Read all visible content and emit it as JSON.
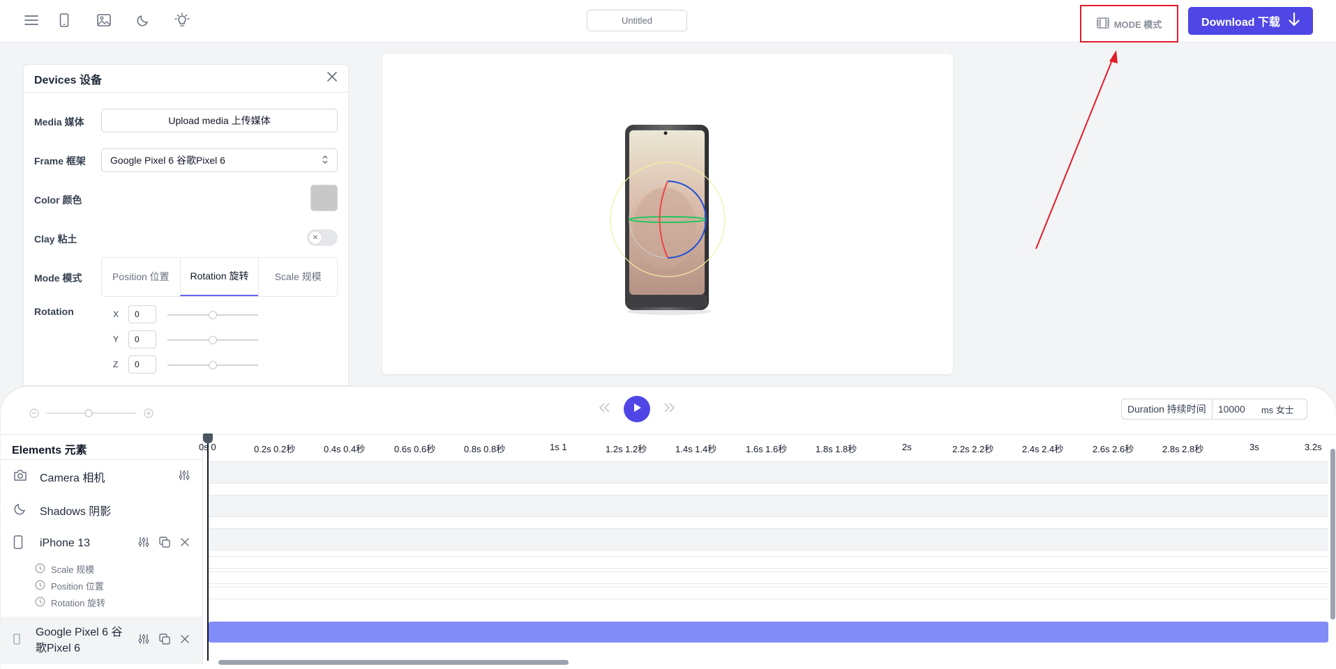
{
  "header": {
    "title": "Untitled",
    "mode_label": "MODE 模式",
    "download_label": "Download 下载"
  },
  "devices_panel": {
    "title": "Devices 设备",
    "media_label": "Media 媒体",
    "upload_label": "Upload media 上传媒体",
    "frame_label": "Frame 框架",
    "frame_value": "Google Pixel 6 谷歌Pixel 6",
    "color_label": "Color 颜色",
    "color_value": "#c8c8c8",
    "clay_label": "Clay 粘土",
    "mode_label": "Mode 模式",
    "mode_tabs": [
      "Position 位置",
      "Rotation 旋转",
      "Scale 规模"
    ],
    "active_mode": "Rotation 旋转",
    "rotation_label": "Rotation",
    "rotation": [
      {
        "axis": "X",
        "value": "0"
      },
      {
        "axis": "Y",
        "value": "0"
      },
      {
        "axis": "Z",
        "value": "0"
      }
    ]
  },
  "timeline": {
    "duration_label": "Duration 持续时间",
    "duration_value": "10000",
    "duration_unit": "ms 女士",
    "elements_title": "Elements 元素",
    "elements": [
      {
        "name": "Camera 相机",
        "icon": "camera-icon"
      },
      {
        "name": "Shadows 阴影",
        "icon": "moon-icon"
      },
      {
        "name": "iPhone 13",
        "icon": "phone-icon",
        "children": [
          "Scale 规模",
          "Position 位置",
          "Rotation 旋转"
        ]
      },
      {
        "name": "Google Pixel 6 谷歌Pixel 6",
        "icon": "phone-icon"
      }
    ],
    "ticks": [
      "0s 0",
      "0.2s 0.2秒",
      "0.4s 0.4秒",
      "0.6s 0.6秒",
      "0.8s 0.8秒",
      "1s 1",
      "1.2s 1.2秒",
      "1.4s 1.4秒",
      "1.6s 1.6秒",
      "1.8s 1.8秒",
      "2s",
      "2.2s 2.2秒",
      "2.4s 2.4秒",
      "2.6s 2.6秒",
      "2.8s 2.8秒",
      "3s",
      "3.2s"
    ]
  },
  "colors": {
    "accent": "#4f46e5",
    "highlight_box": "#e11d2a",
    "clip": "#818cf8"
  }
}
